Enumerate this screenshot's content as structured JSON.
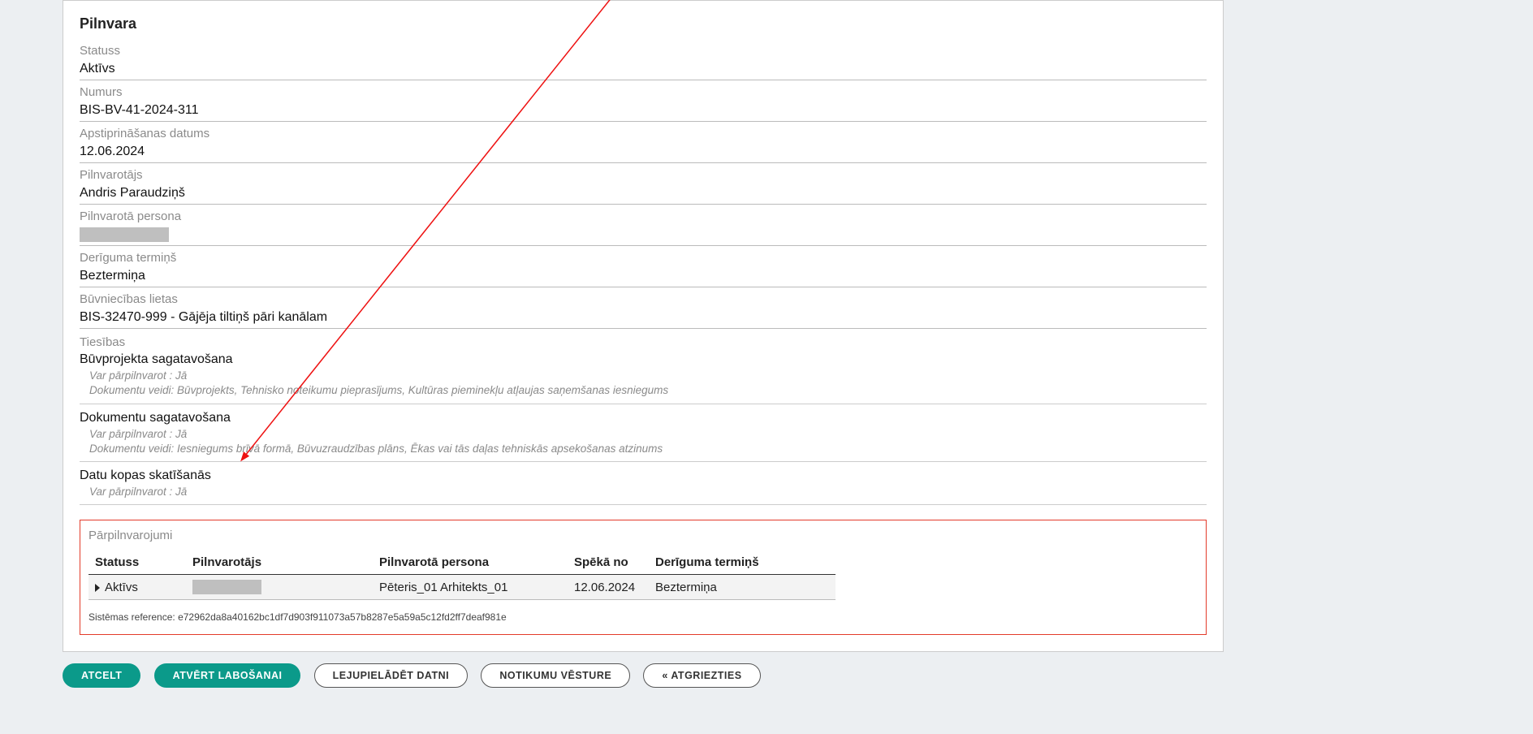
{
  "title": "Pilnvara",
  "fields": {
    "status_label": "Statuss",
    "status_value": "Aktīvs",
    "number_label": "Numurs",
    "number_value": "BIS-BV-41-2024-311",
    "approval_label": "Apstiprināšanas datums",
    "approval_value": "12.06.2024",
    "grantor_label": "Pilnvarotājs",
    "grantor_value": "Andris Paraudziņš",
    "grantee_label": "Pilnvarotā persona",
    "validity_label": "Derīguma termiņš",
    "validity_value": "Beztermiņa",
    "cases_label": "Būvniecības lietas",
    "cases_value": "BIS-32470-999 - Gājēja tiltiņš pāri kanālam",
    "rights_label": "Tiesības"
  },
  "rights": [
    {
      "title": "Būvprojekta sagatavošana",
      "sub1": "Var pārpilnvarot : Jā",
      "sub2": "Dokumentu veidi: Būvprojekts, Tehnisko noteikumu pieprasījums, Kultūras pieminekļu atļaujas saņemšanas iesniegums"
    },
    {
      "title": "Dokumentu sagatavošana",
      "sub1": "Var pārpilnvarot : Jā",
      "sub2": "Dokumentu veidi: Iesniegums brīvā formā, Būvuzraudzības plāns, Ēkas vai tās daļas tehniskās apsekošanas atzinums"
    },
    {
      "title": "Datu kopas skatīšanās",
      "sub1": "Var pārpilnvarot : Jā",
      "sub2": ""
    }
  ],
  "box": {
    "title": "Pārpilnvarojumi",
    "headers": {
      "status": "Statuss",
      "grantor": "Pilnvarotājs",
      "grantee": "Pilnvarotā persona",
      "from": "Spēkā no",
      "term": "Derīguma termiņš"
    },
    "row": {
      "status": "Aktīvs",
      "grantee": "Pēteris_01 Arhitekts_01",
      "from": "12.06.2024",
      "term": "Beztermiņa"
    }
  },
  "sysref": {
    "label": "Sistēmas reference:",
    "value": "e72962da8a40162bc1df7d903f911073a57b8287e5a59a5c12fd2ff7deaf981e"
  },
  "buttons": {
    "cancel": "Atcelt",
    "edit": "Atvērt labošanai",
    "download": "Lejupielādēt datni",
    "history": "Notikumu vēsture",
    "back": "« Atgriezties"
  }
}
